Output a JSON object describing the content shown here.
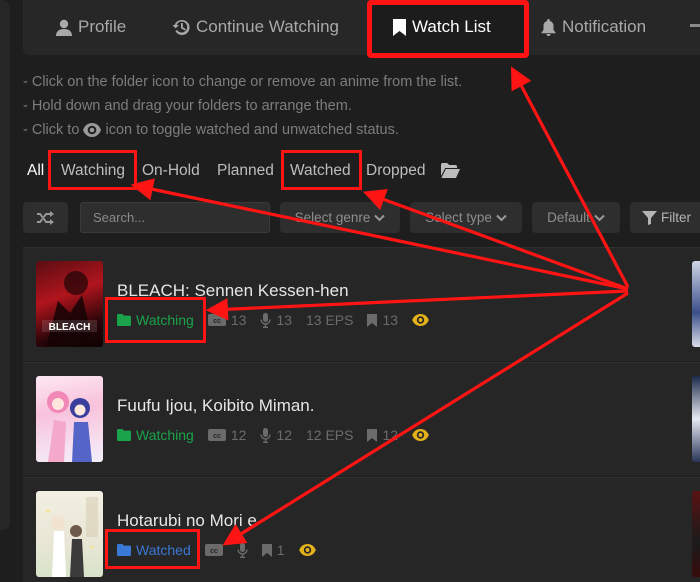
{
  "tabs": [
    {
      "label": "Profile",
      "icon": "user-icon"
    },
    {
      "label": "Continue Watching",
      "icon": "history-icon"
    },
    {
      "label": "Watch List",
      "icon": "bookmark-icon",
      "active": true
    },
    {
      "label": "Notification",
      "icon": "bell-icon"
    }
  ],
  "tips": {
    "line1": "- Click on the folder icon to change or remove an anime from the list.",
    "line2": "- Hold down and drag your folders to arrange them.",
    "line3_before": "- Click to",
    "line3_after": "icon to toggle watched and unwatched status."
  },
  "folders": {
    "all": "All",
    "items": [
      "Watching",
      "On-Hold",
      "Planned",
      "Watched",
      "Dropped"
    ]
  },
  "filters": {
    "search_placeholder": "Search...",
    "genre": "Select genre",
    "type": "Select type",
    "sort": "Default",
    "filter": "Filter"
  },
  "list": [
    {
      "title": "BLEACH: Sennen Kessen-hen",
      "status": "Watching",
      "sub": "13",
      "dub": "13",
      "eps": "13 EPS",
      "bookmark": "13",
      "poster_text": "BLEACH"
    },
    {
      "title": "Fuufu Ijou, Koibito Miman.",
      "status": "Watching",
      "sub": "12",
      "dub": "12",
      "eps": "12 EPS",
      "bookmark": "12"
    },
    {
      "title": "Hotarubi no Mori e",
      "status": "Watched",
      "bookmark": "1"
    }
  ],
  "colors": {
    "background": "#1e1e1e",
    "watching": "#1aa34a",
    "watched": "#3a79d6",
    "eye": "#e3b21a",
    "highlight": "#ff1414"
  }
}
